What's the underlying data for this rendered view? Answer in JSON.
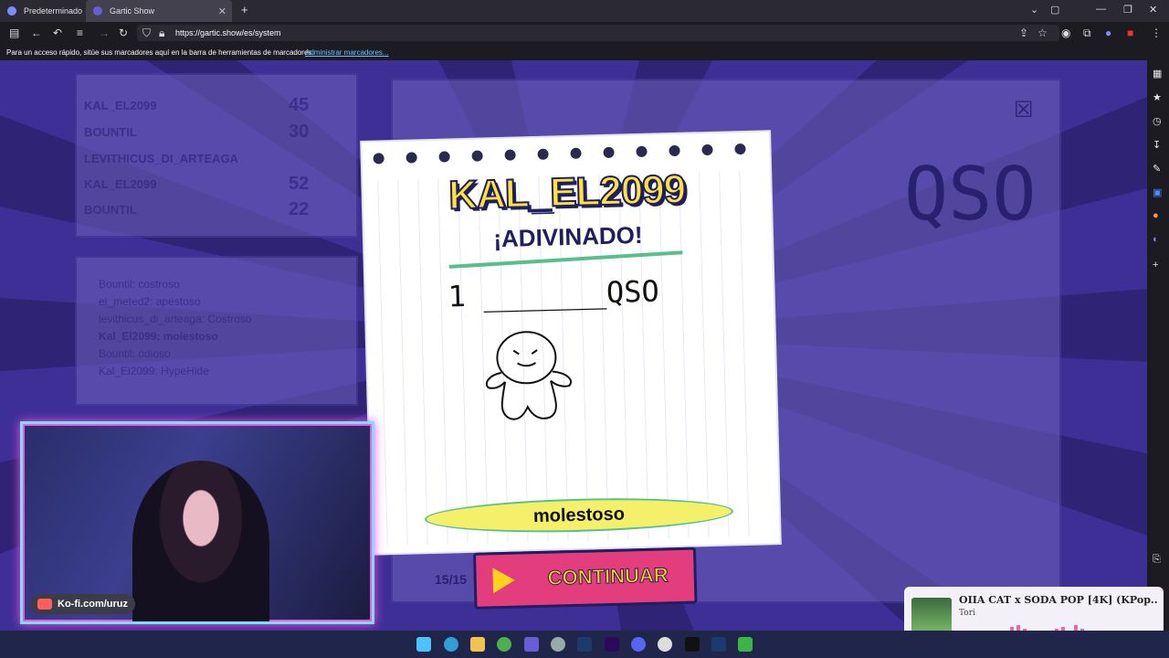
{
  "browser": {
    "tabs": [
      {
        "label": "Predeterminado",
        "active": false
      },
      {
        "label": "Gartic Show",
        "active": true
      }
    ],
    "new_tab_icon": "plus-icon",
    "url": "https://gartic.show/es/system",
    "bookmarks_hint": "Para un acceso rápido, sitúe sus marcadores aquí en la barra de herramientas de marcadores.",
    "bookmarks_manage": "Administrar marcadores..."
  },
  "game": {
    "ranking": [
      {
        "name": "KAL_EL2099",
        "score": "45"
      },
      {
        "name": "BOUNTIL",
        "score": "30"
      },
      {
        "name": "LEVITHICUS_DI_ARTEAGA",
        "score": ""
      },
      {
        "name": "KAL_EL2099",
        "score": "52"
      },
      {
        "name": "BOUNTIL",
        "score": "22"
      }
    ],
    "chat": [
      "Bountil: costroso",
      "el_meted2: apestoso",
      "levithicus_di_arteaga: Costroso",
      "Kal_El2099: molestoso",
      "Bountil: odioso",
      "Kal_El2099: HypeHide"
    ],
    "bg_word": "QSO",
    "round": "15/15",
    "winner_name": "KAL_EL2099",
    "guessed_label": "¡ADIVINADO!",
    "hint": "1 _______QSO",
    "answer": "molestoso",
    "continue_label": "CONTINUAR",
    "accent_yellow": "#ffe23a",
    "accent_pink": "#e43d7e"
  },
  "overlay": {
    "kofi": "Ko-fi.com/uruz",
    "music_title": "OIIA CAT x SODA POP [4K] (KPop...",
    "music_artist": "Tori"
  }
}
